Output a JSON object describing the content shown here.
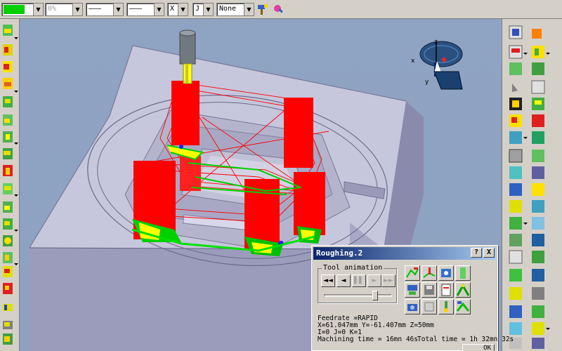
{
  "toolbar": {
    "color_swatch": "#00d000",
    "transparency": "0%",
    "line_thickness": "———",
    "line_type": "———",
    "point_symbol": "X",
    "layer": "None",
    "layer_icon_text": "J"
  },
  "compass": {
    "x": "x",
    "y": "y",
    "z": "z"
  },
  "dialog": {
    "title": "Roughing.2",
    "help": "?",
    "close": "X",
    "group_label": "Tool animation",
    "buttons": [
      "◄◄",
      "◄",
      "▌▌",
      "►",
      "►►"
    ],
    "feedrate": "Feedrate =RAPID",
    "coords": "X=61.047mm Y=-61.407mm Z=50mm",
    "ijk": "I=0 J=0 K=1",
    "machining_time": "Machining time = 16mn 46s",
    "total_time": "Total time = 1h 32mn 32s",
    "ok": "OK"
  },
  "colors": {
    "viewport_bg": "#8fa3c2",
    "part_top": "#c8c8dc",
    "part_side": "#9a9ab8",
    "toolpath_red": "#ff0000",
    "toolpath_green": "#00d000",
    "toolpath_yellow": "#ffff00",
    "toolpath_blue": "#2020ff",
    "title_bar": "#0a246a"
  }
}
